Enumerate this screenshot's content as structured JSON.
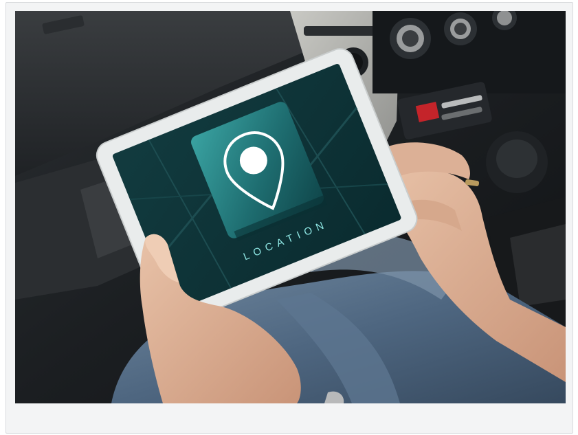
{
  "photo": {
    "screen_label": "LOCATION",
    "icon": "map-pin-icon"
  },
  "colors": {
    "card_background": "#f3f4f5",
    "card_border": "#d8dadd",
    "screen_teal_dark": "#0b3438",
    "screen_teal_light": "#2e8a8a",
    "pin_white": "#ffffff",
    "tablet_frame": "#eef0f0",
    "car_dark": "#1c1f22"
  }
}
